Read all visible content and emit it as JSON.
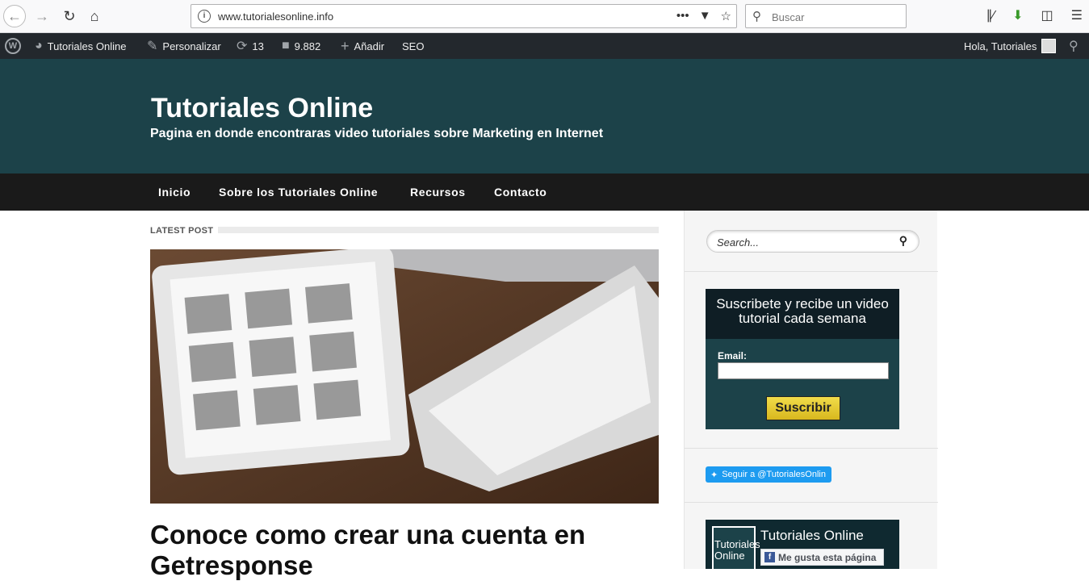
{
  "browser": {
    "url": "www.tutorialesonline.info",
    "search_placeholder": "Buscar",
    "url_actions_icon": "more-dots-icon"
  },
  "admin_bar": {
    "site_name": "Tutoriales Online",
    "customize": "Personalizar",
    "updates_count": "13",
    "comments_count": "9.882",
    "add_new": "Añadir",
    "seo": "SEO",
    "greeting": "Hola, Tutoriales"
  },
  "header": {
    "title": "Tutoriales Online",
    "description": "Pagina en donde encontraras video tutoriales sobre Marketing en Internet"
  },
  "nav": {
    "items": [
      "Inicio",
      "Sobre los Tutoriales Online",
      "Recursos",
      "Contacto"
    ]
  },
  "content": {
    "section_label": "LATEST POST",
    "post_title": "Conoce como crear una cuenta en Getresponse"
  },
  "sidebar": {
    "search_placeholder": "Search...",
    "subscribe_heading": "Suscribete y recibe un video tutorial cada semana",
    "email_label": "Email:",
    "subscribe_button": "Suscribir",
    "twitter_button": "Seguir a @TutorialesOnlin",
    "fb_thumb_text": "Tutoriales Online",
    "fb_page_name": "Tutoriales Online",
    "fb_like_button": "Me gusta esta página"
  },
  "colors": {
    "header_bg": "#1c4249",
    "nav_bg": "#1a1a1a",
    "admin_bar_bg": "#23282d",
    "subscribe_button": "#e8c933",
    "twitter_blue": "#1d9bf0"
  }
}
